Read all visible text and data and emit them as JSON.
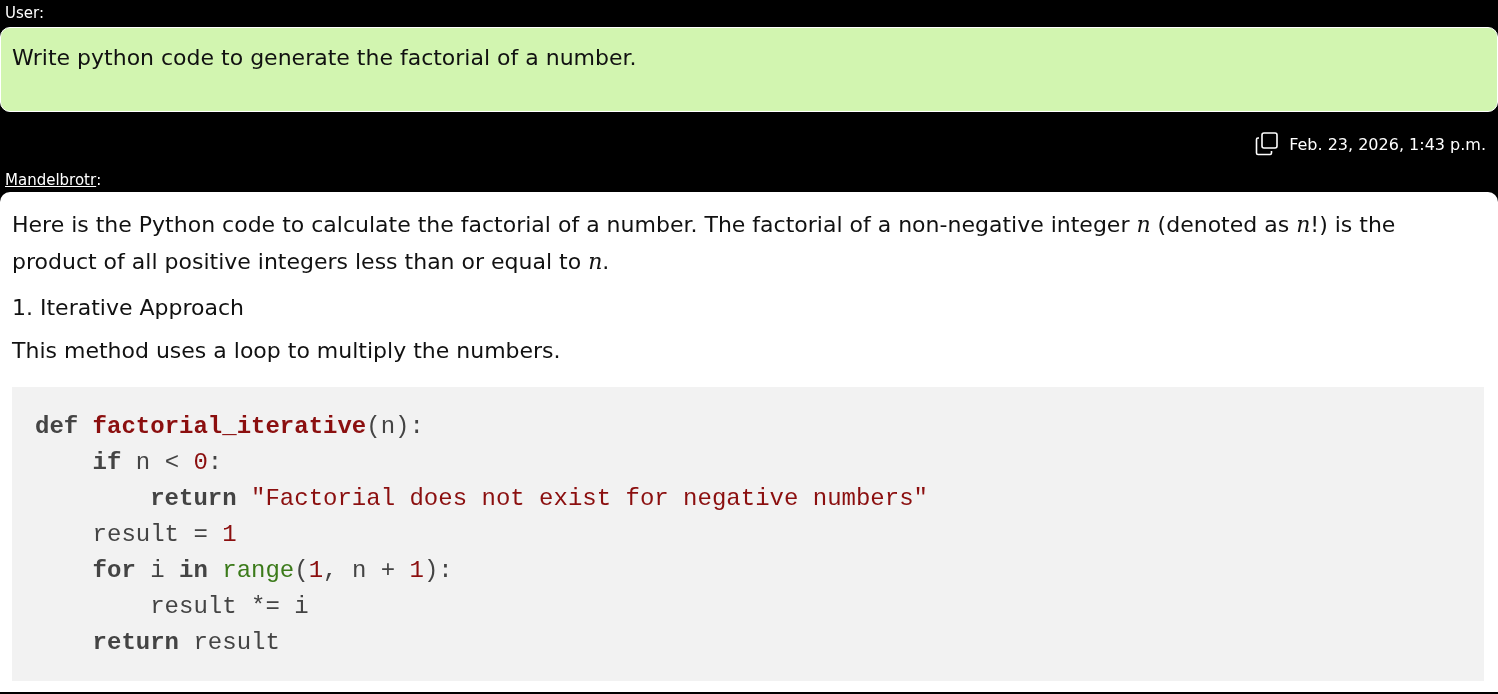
{
  "messages": [
    {
      "kind": "user",
      "author": "User:",
      "text": "Write python code to generate the factorial of a number.",
      "timestamp": "Feb. 23, 2026, 1:43 p.m."
    },
    {
      "kind": "assistant",
      "author": "Mandelbrotr",
      "author_suffix": ":",
      "blocks": [
        {
          "kind": "paragraph",
          "text": "Here is the Python code to calculate the factorial of a number. The factorial of a non-negative integer *n* (denoted as *n*!) is the product of all positive integers less than or equal to *n*."
        },
        {
          "kind": "heading",
          "text": "1. Iterative Approach"
        },
        {
          "kind": "paragraph",
          "text": "This method uses a loop to multiply the numbers."
        },
        {
          "kind": "code",
          "lines": [
            {
              "tokens": [
                {
                  "kind": "keyword",
                  "text": "def"
                },
                {
                  "kind": "function",
                  "text": " factorial_iterative"
                },
                {
                  "kind": "plain",
                  "text": "(n):"
                }
              ],
              "children": [
                {
                  "tokens": [
                    {
                      "kind": "keyword",
                      "text": "if"
                    },
                    {
                      "kind": "plain",
                      "text": " n < "
                    },
                    {
                      "kind": "number",
                      "text": "0"
                    },
                    {
                      "kind": "plain",
                      "text": ":"
                    }
                  ],
                  "children": [
                    {
                      "tokens": [
                        {
                          "kind": "keyword",
                          "text": "return"
                        },
                        {
                          "kind": "string",
                          "text": " \"Factorial does not exist for negative numbers\""
                        }
                      ]
                    }
                  ]
                },
                {
                  "tokens": [
                    {
                      "kind": "plain",
                      "text": "result = "
                    },
                    {
                      "kind": "number",
                      "text": "1"
                    }
                  ]
                },
                {
                  "tokens": [
                    {
                      "kind": "keyword",
                      "text": "for"
                    },
                    {
                      "kind": "plain",
                      "text": " i "
                    },
                    {
                      "kind": "keyword",
                      "text": "in"
                    },
                    {
                      "kind": "builtin",
                      "text": " range"
                    },
                    {
                      "kind": "plain",
                      "text": "("
                    },
                    {
                      "kind": "number",
                      "text": "1"
                    },
                    {
                      "kind": "plain",
                      "text": ", n + "
                    },
                    {
                      "kind": "number",
                      "text": "1"
                    },
                    {
                      "kind": "plain",
                      "text": "):"
                    }
                  ],
                  "children": [
                    {
                      "tokens": [
                        {
                          "kind": "plain",
                          "text": "result *= i"
                        }
                      ]
                    }
                  ]
                },
                {
                  "tokens": [
                    {
                      "kind": "keyword",
                      "text": "return"
                    },
                    {
                      "kind": "plain",
                      "text": " result"
                    }
                  ]
                }
              ]
            }
          ]
        }
      ]
    }
  ]
}
